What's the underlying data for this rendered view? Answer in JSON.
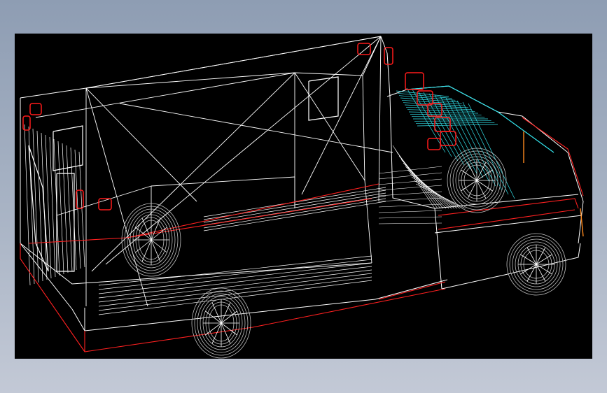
{
  "viewport": {
    "background": "#000000",
    "colors": {
      "body_wireframe": "#ffffff",
      "chassis_lines": "#ff2020",
      "cab_windshield": "#33e5ee",
      "lights": "#ff1a1a",
      "wheels": "#bfbfbf",
      "trim": "#ff8a1e"
    }
  }
}
